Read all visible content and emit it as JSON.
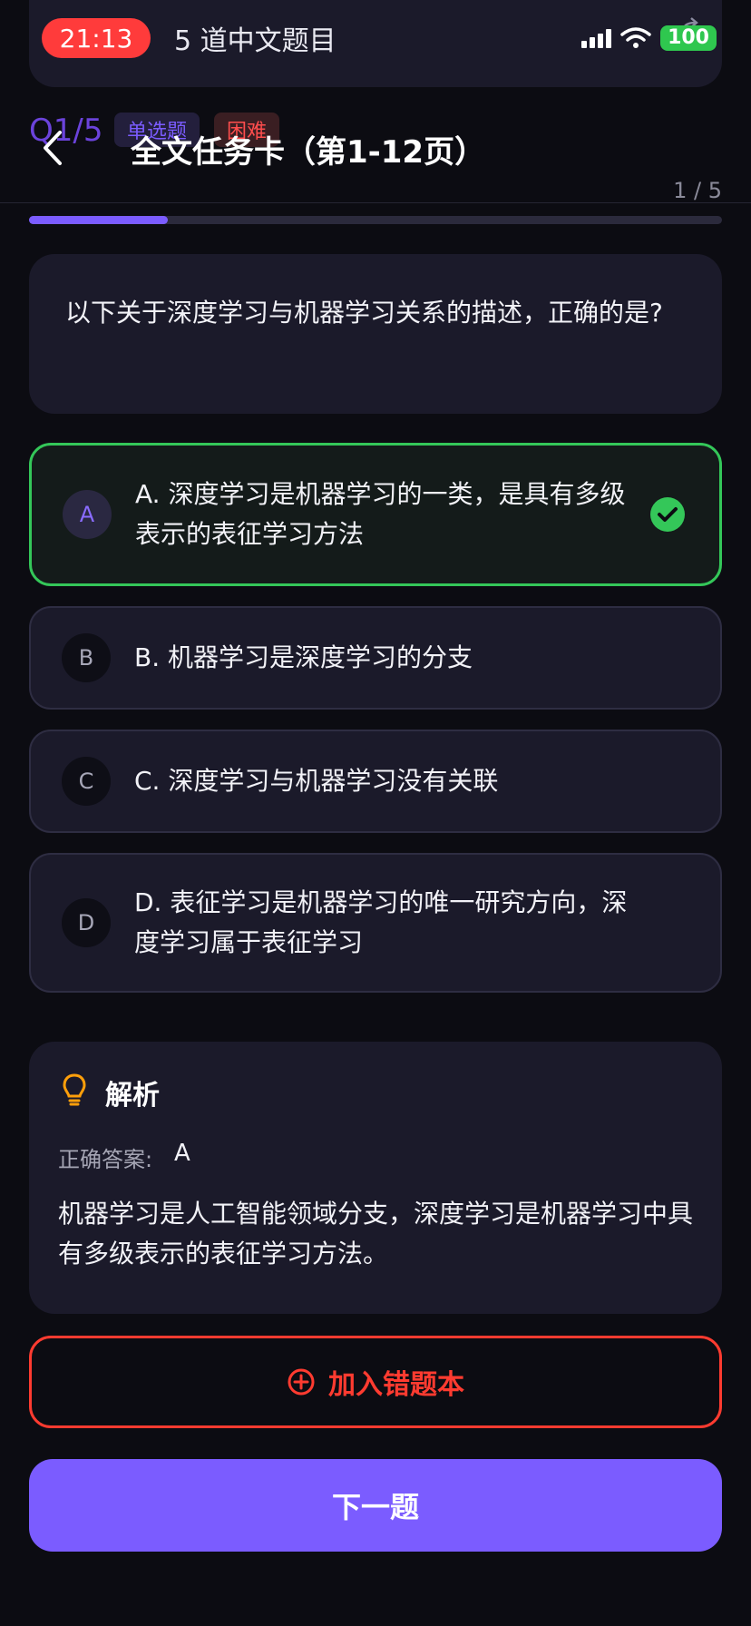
{
  "status_bar": {
    "time": "21:13",
    "battery": "100"
  },
  "top_card": {
    "title": "5 道中文题目"
  },
  "header": {
    "question_index": "Q1/5",
    "type_tag": "单选题",
    "difficulty_tag": "困难",
    "title": "全文任务卡（第1-12页）",
    "count": "1 / 5"
  },
  "progress": {
    "fraction": 0.2
  },
  "question": {
    "text": "以下关于深度学习与机器学习关系的描述，正确的是?"
  },
  "options": [
    {
      "letter": "A",
      "text": "A. 深度学习是机器学习的一类，是具有多级表示的表征学习方法",
      "state": "correct"
    },
    {
      "letter": "B",
      "text": "B. 机器学习是深度学习的分支",
      "state": "normal"
    },
    {
      "letter": "C",
      "text": "C. 深度学习与机器学习没有关联",
      "state": "normal"
    },
    {
      "letter": "D",
      "text": "D. 表征学习是机器学习的唯一研究方向，深度学习属于表征学习",
      "state": "normal"
    }
  ],
  "analysis": {
    "title": "解析",
    "answer_label": "正确答案:",
    "answer_value": "A",
    "text": "机器学习是人工智能领域分支，深度学习是机器学习中具有多级表示的表征学习方法。"
  },
  "buttons": {
    "add_mistake": "加入错题本",
    "next": "下一题"
  },
  "colors": {
    "accent": "#7b5cff",
    "correct": "#34c759",
    "danger": "#ff3b30"
  }
}
